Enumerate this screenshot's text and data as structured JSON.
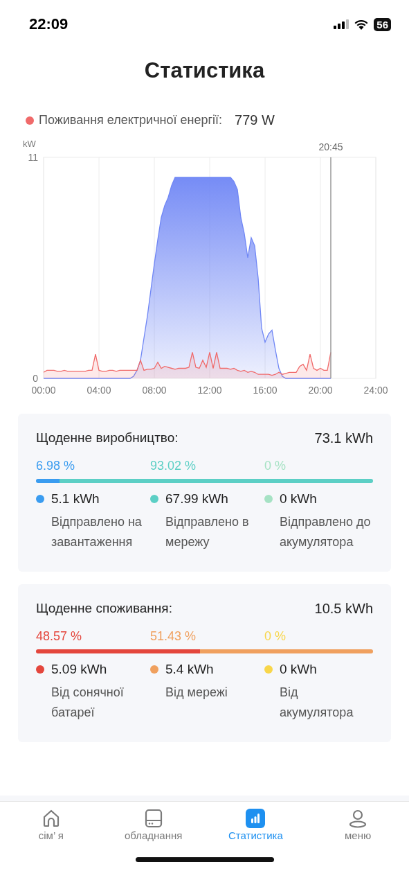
{
  "status_bar": {
    "time": "22:09",
    "battery": "56"
  },
  "title": "Статистика",
  "consumption_now": {
    "label": "Поживання електричної енергії:",
    "value": "779 W",
    "color": "#f06a6a"
  },
  "chart_data": {
    "type": "area",
    "grid": true,
    "ylabel": "kW",
    "ylim": [
      0,
      11
    ],
    "yticks": [
      0,
      11
    ],
    "xlim": [
      0,
      24
    ],
    "xticks": [
      {
        "value": 0,
        "label": "00:00"
      },
      {
        "value": 4,
        "label": "04:00"
      },
      {
        "value": 8,
        "label": "08:00"
      },
      {
        "value": 12,
        "label": "12:00"
      },
      {
        "value": 16,
        "label": "16:00"
      },
      {
        "value": 20,
        "label": "20:00"
      },
      {
        "value": 24,
        "label": "24:00"
      }
    ],
    "x": [
      0,
      0.25,
      0.5,
      0.75,
      1,
      1.25,
      1.5,
      1.75,
      2,
      2.25,
      2.5,
      2.75,
      3,
      3.25,
      3.5,
      3.75,
      4,
      4.25,
      4.5,
      4.75,
      5,
      5.25,
      5.5,
      5.75,
      6,
      6.25,
      6.5,
      6.75,
      7,
      7.25,
      7.5,
      7.75,
      8,
      8.25,
      8.5,
      8.75,
      9,
      9.25,
      9.5,
      9.75,
      10,
      10.25,
      10.5,
      10.75,
      11,
      11.25,
      11.5,
      11.75,
      12,
      12.25,
      12.5,
      12.75,
      13,
      13.25,
      13.5,
      13.75,
      14,
      14.25,
      14.5,
      14.75,
      15,
      15.25,
      15.5,
      15.75,
      16,
      16.25,
      16.5,
      16.75,
      17,
      17.25,
      17.5,
      17.75,
      18,
      18.25,
      18.5,
      18.75,
      19,
      19.25,
      19.5,
      19.75,
      20,
      20.25,
      20.5,
      20.75
    ],
    "series": [
      {
        "color": "#6f86f5",
        "values": [
          0,
          0,
          0,
          0,
          0,
          0,
          0,
          0,
          0,
          0,
          0,
          0,
          0,
          0,
          0,
          0,
          0,
          0,
          0,
          0,
          0,
          0,
          0,
          0,
          0,
          0,
          0.1,
          0.4,
          0.9,
          2.0,
          3.1,
          4.4,
          5.7,
          6.9,
          8.0,
          8.6,
          9.0,
          9.6,
          10.0,
          10.0,
          10.0,
          10.0,
          10.0,
          10.0,
          10.0,
          10.0,
          10.0,
          10.0,
          10.0,
          10.0,
          10.0,
          10.0,
          10.0,
          10.0,
          10.0,
          9.8,
          9.4,
          8.0,
          7.2,
          6.0,
          7.0,
          6.6,
          5.0,
          2.5,
          1.8,
          2.2,
          2.4,
          1.4,
          0.5,
          0.1,
          0,
          0,
          0,
          0,
          0,
          0,
          0,
          0,
          0,
          0,
          0,
          0,
          0,
          0
        ]
      },
      {
        "color": "#f06a6a",
        "values": [
          0.3,
          0.4,
          0.4,
          0.4,
          0.35,
          0.35,
          0.4,
          0.35,
          0.35,
          0.35,
          0.35,
          0.35,
          0.35,
          0.4,
          0.4,
          1.2,
          0.4,
          0.35,
          0.35,
          0.4,
          0.4,
          0.35,
          0.4,
          0.4,
          0.4,
          0.4,
          0.4,
          0.4,
          0.9,
          0.4,
          0.45,
          0.45,
          0.5,
          0.8,
          0.5,
          0.6,
          0.55,
          0.5,
          0.45,
          0.5,
          0.5,
          0.5,
          0.55,
          1.3,
          0.55,
          0.5,
          0.9,
          0.55,
          1.3,
          0.5,
          1.3,
          0.5,
          0.5,
          0.5,
          0.45,
          0.5,
          0.4,
          0.35,
          0.4,
          0.3,
          0.35,
          0.3,
          0.2,
          0.2,
          0.2,
          0.2,
          0.15,
          0.2,
          0.3,
          0.2,
          0.25,
          0.3,
          0.3,
          0.3,
          0.6,
          0.7,
          0.4,
          1.2,
          0.5,
          0.4,
          0.5,
          0.4,
          0.4,
          1.3
        ]
      }
    ],
    "annotations": [
      {
        "x": 20.75,
        "text": "20:45"
      }
    ]
  },
  "cards": [
    {
      "title": "Щоденне виробництво:",
      "total": "73.1 kWh",
      "segments": [
        {
          "percent": "6.98 %",
          "color": "#3a9cf0",
          "value": "5.1 kWh",
          "label": "Відправлено на завантаження"
        },
        {
          "percent": "93.02 %",
          "color": "#5ccfc5",
          "value": "67.99 kWh",
          "label": "Відправлено в мережу"
        },
        {
          "percent": "0 %",
          "color": "#a6e2c4",
          "value": "0 kWh",
          "label": "Відправлено до акумулятора"
        }
      ]
    },
    {
      "title": "Щоденне споживання:",
      "total": "10.5 kWh",
      "segments": [
        {
          "percent": "48.57 %",
          "color": "#e4463c",
          "value": "5.09 kWh",
          "label": "Від сонячної батареї"
        },
        {
          "percent": "51.43 %",
          "color": "#f0a05e",
          "value": "5.4 kWh",
          "label": "Від мережі"
        },
        {
          "percent": "0 %",
          "color": "#f8d64a",
          "value": "0 kWh",
          "label": "Від акумулятора"
        }
      ]
    }
  ],
  "nav": [
    {
      "label": "сім’ я",
      "selected": false
    },
    {
      "label": "обладнання",
      "selected": false
    },
    {
      "label": "Статистика",
      "selected": true
    },
    {
      "label": "меню",
      "selected": false
    }
  ]
}
